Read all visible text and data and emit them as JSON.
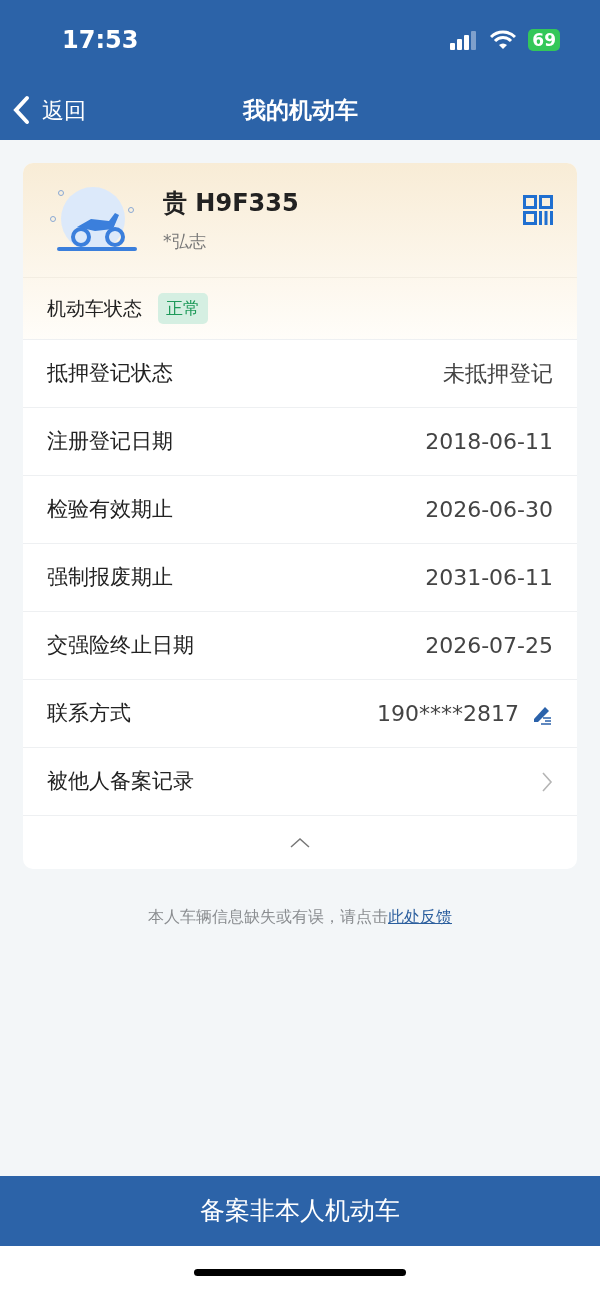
{
  "status_bar": {
    "time": "17:53",
    "battery": "69"
  },
  "nav": {
    "back": "返回",
    "title": "我的机动车"
  },
  "vehicle": {
    "plate": "贵 H9F335",
    "owner": "*弘志",
    "status_label": "机动车状态",
    "status": "正常"
  },
  "rows": [
    {
      "kind": "value",
      "label": "抵押登记状态",
      "value": "未抵押登记"
    },
    {
      "kind": "value",
      "label": "注册登记日期",
      "value": "2018-06-11"
    },
    {
      "kind": "value",
      "label": "检验有效期止",
      "value": "2026-06-30"
    },
    {
      "kind": "value",
      "label": "强制报废期止",
      "value": "2031-06-11"
    },
    {
      "kind": "value",
      "label": "交强险终止日期",
      "value": "2026-07-25"
    },
    {
      "kind": "editable",
      "label": "联系方式",
      "value": "190****2817"
    },
    {
      "kind": "link",
      "label": "被他人备案记录"
    }
  ],
  "note": {
    "text": "本人车辆信息缺失或有误，请点击",
    "link": "此处反馈"
  },
  "bottom_button": "备案非本人机动车"
}
